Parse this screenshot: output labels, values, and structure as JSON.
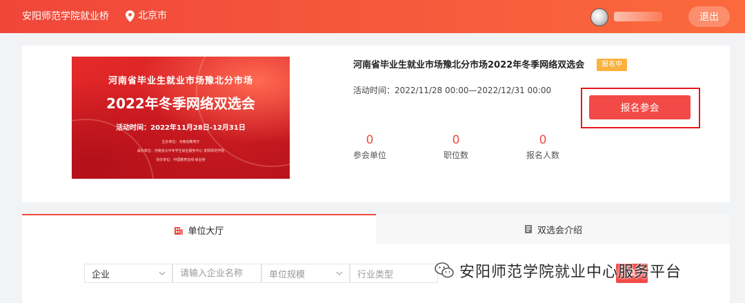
{
  "header": {
    "school_name": "安阳师范学院就业桥",
    "location": "北京市",
    "logout_label": "退出"
  },
  "event": {
    "title": "河南省毕业生就业市场豫北分市场2022年冬季网络双选会",
    "status_badge": "报名中",
    "time_label": "活动时间：2022/11/28 00:00—2022/12/31 00:00",
    "signup_label": "报名参会",
    "poster": {
      "line1": "河南省毕业生就业市场豫北分市场",
      "line2": "2022年冬季网络双选会",
      "line3": "活动时间：2022年11月28日-12月31日",
      "organizer": "主办单位：河南省教育厅",
      "host": "承办单位：河南省大中专学生就业服务中心  安阳师范学院",
      "co_host": "协办单位：中国教育在线·就业桥"
    },
    "stats": [
      {
        "value": "0",
        "label": "参会单位"
      },
      {
        "value": "0",
        "label": "职位数"
      },
      {
        "value": "0",
        "label": "报名人数"
      }
    ]
  },
  "tabs": [
    {
      "label": "单位大厅",
      "icon": "building-icon",
      "active": true
    },
    {
      "label": "双选会介绍",
      "icon": "book-icon",
      "active": false
    }
  ],
  "filters": {
    "type_select": "企业",
    "name_placeholder": "请输入企业名称",
    "scale_select": "单位规模",
    "industry_select": "行业类型"
  },
  "watermark": {
    "text": "安阳师范学院就业中心服务平台",
    "icon": "wechat-icon"
  },
  "colors": {
    "brand": "#f04a3e",
    "badge": "#fbb13c",
    "highlight_frame": "#e8141c"
  }
}
